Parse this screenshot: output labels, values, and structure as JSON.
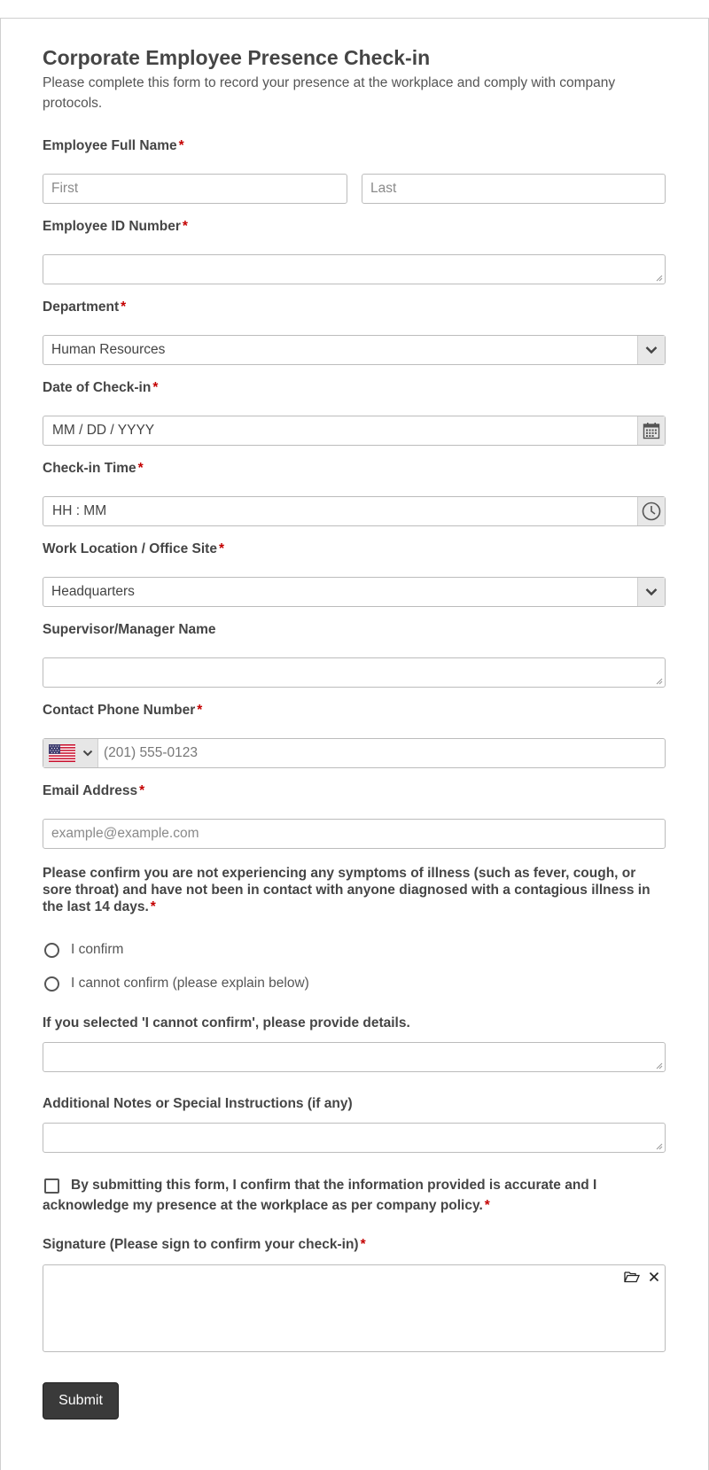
{
  "form": {
    "title": "Corporate Employee Presence Check-in",
    "description": "Please complete this form to record your presence at the workplace and comply with company protocols.",
    "required_mark": "*",
    "name": {
      "label": "Employee Full Name",
      "first_placeholder": "First",
      "last_placeholder": "Last"
    },
    "employee_id": {
      "label": "Employee ID Number",
      "value": ""
    },
    "department": {
      "label": "Department",
      "selected": "Human Resources"
    },
    "date": {
      "label": "Date of Check-in",
      "placeholder": "MM / DD / YYYY"
    },
    "time": {
      "label": "Check-in Time",
      "placeholder": "HH : MM"
    },
    "location": {
      "label": "Work Location / Office Site",
      "selected": "Headquarters"
    },
    "supervisor": {
      "label": "Supervisor/Manager Name",
      "value": ""
    },
    "phone": {
      "label": "Contact Phone Number",
      "placeholder": "(201) 555-0123"
    },
    "email": {
      "label": "Email Address",
      "placeholder": "example@example.com"
    },
    "health": {
      "label": "Please confirm you are not experiencing any symptoms of illness (such as fever, cough, or sore throat) and have not been in contact with anyone diagnosed with a contagious illness in the last 14 days.",
      "options": [
        "I confirm",
        "I cannot confirm (please explain below)"
      ]
    },
    "details": {
      "label": "If you selected 'I cannot confirm', please provide details.",
      "value": ""
    },
    "notes": {
      "label": "Additional Notes or Special Instructions (if any)",
      "value": ""
    },
    "consent": {
      "label": "By submitting this form, I confirm that the information provided is accurate and I acknowledge my presence at the workplace as per company policy."
    },
    "signature": {
      "label": "Signature (Please sign to confirm your check-in)"
    },
    "submit_label": "Submit"
  },
  "colors": {
    "required": "#c40000",
    "submit_bg": "#3a3a3a"
  },
  "icons": [
    "chevron-down-icon",
    "calendar-icon",
    "clock-icon",
    "us-flag-icon",
    "folder-open-icon",
    "close-icon"
  ]
}
